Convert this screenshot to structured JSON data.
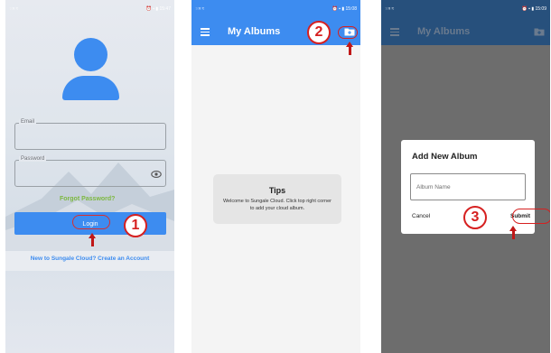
{
  "screen1": {
    "status_left": "⁙ᵍ ≈",
    "status_right": "⏰ ▪ ▮ 15:47",
    "email_label": "Email",
    "email_value": "",
    "password_label": "Password",
    "password_value": "",
    "forgot_password": "Forgot Password?",
    "login_button": "Login",
    "create_account": "New to Sungale Cloud? Create an Account",
    "step_number": "1"
  },
  "screen2": {
    "status_left": "⁙ᵍ ≈",
    "status_right": "⏰ ▪ ▮ 15:08",
    "title": "My Albums",
    "tips_title": "Tips",
    "tips_body": "Welcome to Sungale Cloud. Click top right corner to add your cloud album.",
    "step_number": "2"
  },
  "screen3": {
    "status_left": "⁙ᵍ ≈",
    "status_right": "⏰ ▪ ▮ 15:09",
    "title": "My Albums",
    "dialog_title": "Add New Album",
    "album_name_placeholder": "Album Name",
    "cancel_label": "Cancel",
    "submit_label": "Submit",
    "step_number": "3"
  },
  "colors": {
    "brand_blue": "#3d8cf0",
    "annotation_red": "#d62020",
    "forgot_green": "#7db840"
  },
  "icons": [
    "menu-icon",
    "add-folder-icon",
    "eye-icon",
    "user-avatar-icon",
    "arrow-up-icon"
  ]
}
